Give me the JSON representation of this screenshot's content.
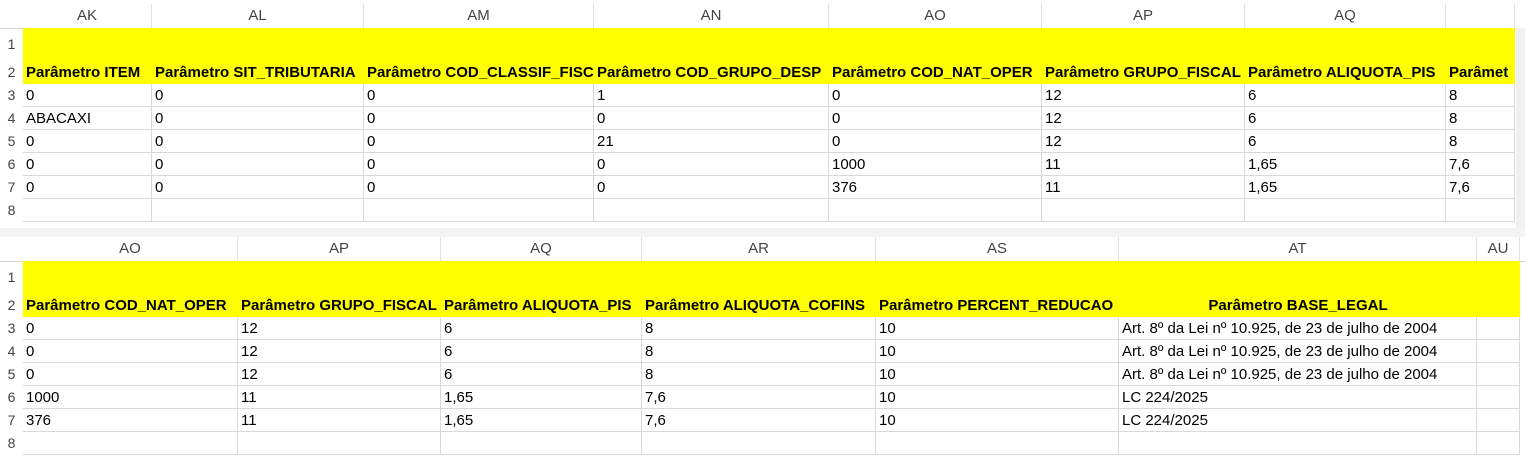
{
  "top": {
    "columns": [
      "AK",
      "AL",
      "AM",
      "AN",
      "AO",
      "AP",
      "AQ",
      ""
    ],
    "row_numbers": [
      "1",
      "2",
      "3",
      "4",
      "5",
      "6",
      "7",
      "8"
    ],
    "header_row": [
      "Parâmetro ITEM",
      "Parâmetro SIT_TRIBUTARIA",
      "Parâmetro COD_CLASSIF_FISC",
      "Parâmetro COD_GRUPO_DESP",
      "Parâmetro COD_NAT_OPER",
      "Parâmetro GRUPO_FISCAL",
      "Parâmetro ALIQUOTA_PIS",
      "Parâmet"
    ],
    "rows": [
      [
        "0",
        "0",
        "0",
        "1",
        "0",
        "12",
        "6",
        "8"
      ],
      [
        "ABACAXI",
        "0",
        "0",
        "0",
        "0",
        "12",
        "6",
        "8"
      ],
      [
        "0",
        "0",
        "0",
        "21",
        "0",
        "12",
        "6",
        "8"
      ],
      [
        "0",
        "0",
        "0",
        "0",
        "1000",
        "11",
        "1,65",
        "7,6"
      ],
      [
        "0",
        "0",
        "0",
        "0",
        "376",
        "11",
        "1,65",
        "7,6"
      ]
    ]
  },
  "bottom": {
    "columns": [
      "AO",
      "AP",
      "AQ",
      "AR",
      "AS",
      "AT",
      "AU"
    ],
    "row_numbers": [
      "1",
      "2",
      "3",
      "4",
      "5",
      "6",
      "7",
      "8"
    ],
    "header_row": [
      "Parâmetro COD_NAT_OPER",
      "Parâmetro GRUPO_FISCAL",
      "Parâmetro ALIQUOTA_PIS",
      "Parâmetro ALIQUOTA_COFINS",
      "Parâmetro PERCENT_REDUCAO",
      "Parâmetro BASE_LEGAL",
      ""
    ],
    "rows": [
      [
        "0",
        "12",
        "6",
        "8",
        "10",
        "Art. 8º da Lei nº 10.925, de 23 de julho de 2004",
        ""
      ],
      [
        "0",
        "12",
        "6",
        "8",
        "10",
        "Art. 8º da Lei nº 10.925, de 23 de julho de 2004",
        ""
      ],
      [
        "0",
        "12",
        "6",
        "8",
        "10",
        "Art. 8º da Lei nº 10.925, de 23 de julho de 2004",
        ""
      ],
      [
        "1000",
        "11",
        "1,65",
        "7,6",
        "10",
        "LC 224/2025",
        ""
      ],
      [
        "376",
        "11",
        "1,65",
        "7,6",
        "10",
        "LC 224/2025",
        ""
      ]
    ]
  },
  "colors": {
    "highlight": "#ffff00",
    "grid": "#d9d9d9"
  }
}
